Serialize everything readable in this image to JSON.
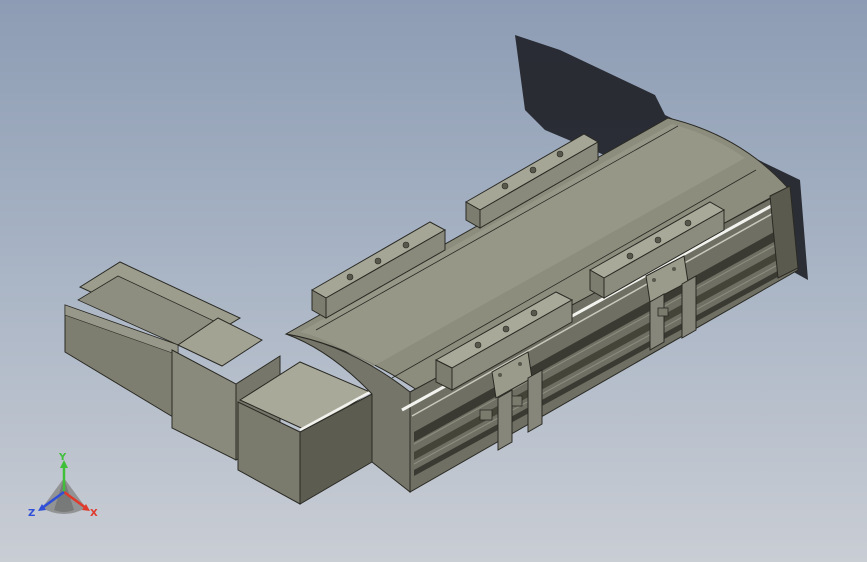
{
  "viewport": {
    "background_top": "#8d9cb4",
    "background_bottom": "#c9cdd4"
  },
  "model": {
    "body_color": "#878778",
    "body_light": "#a0a091",
    "body_dark": "#58584c",
    "edge_color": "#2a2a24",
    "highlight_color": "#f2f2ee",
    "shadow_color": "#1c1c22"
  },
  "triad": {
    "x_label": "X",
    "y_label": "Y",
    "z_label": "Z",
    "x_color": "#e03a2c",
    "y_color": "#3fbf3a",
    "z_color": "#2f4fd8"
  }
}
